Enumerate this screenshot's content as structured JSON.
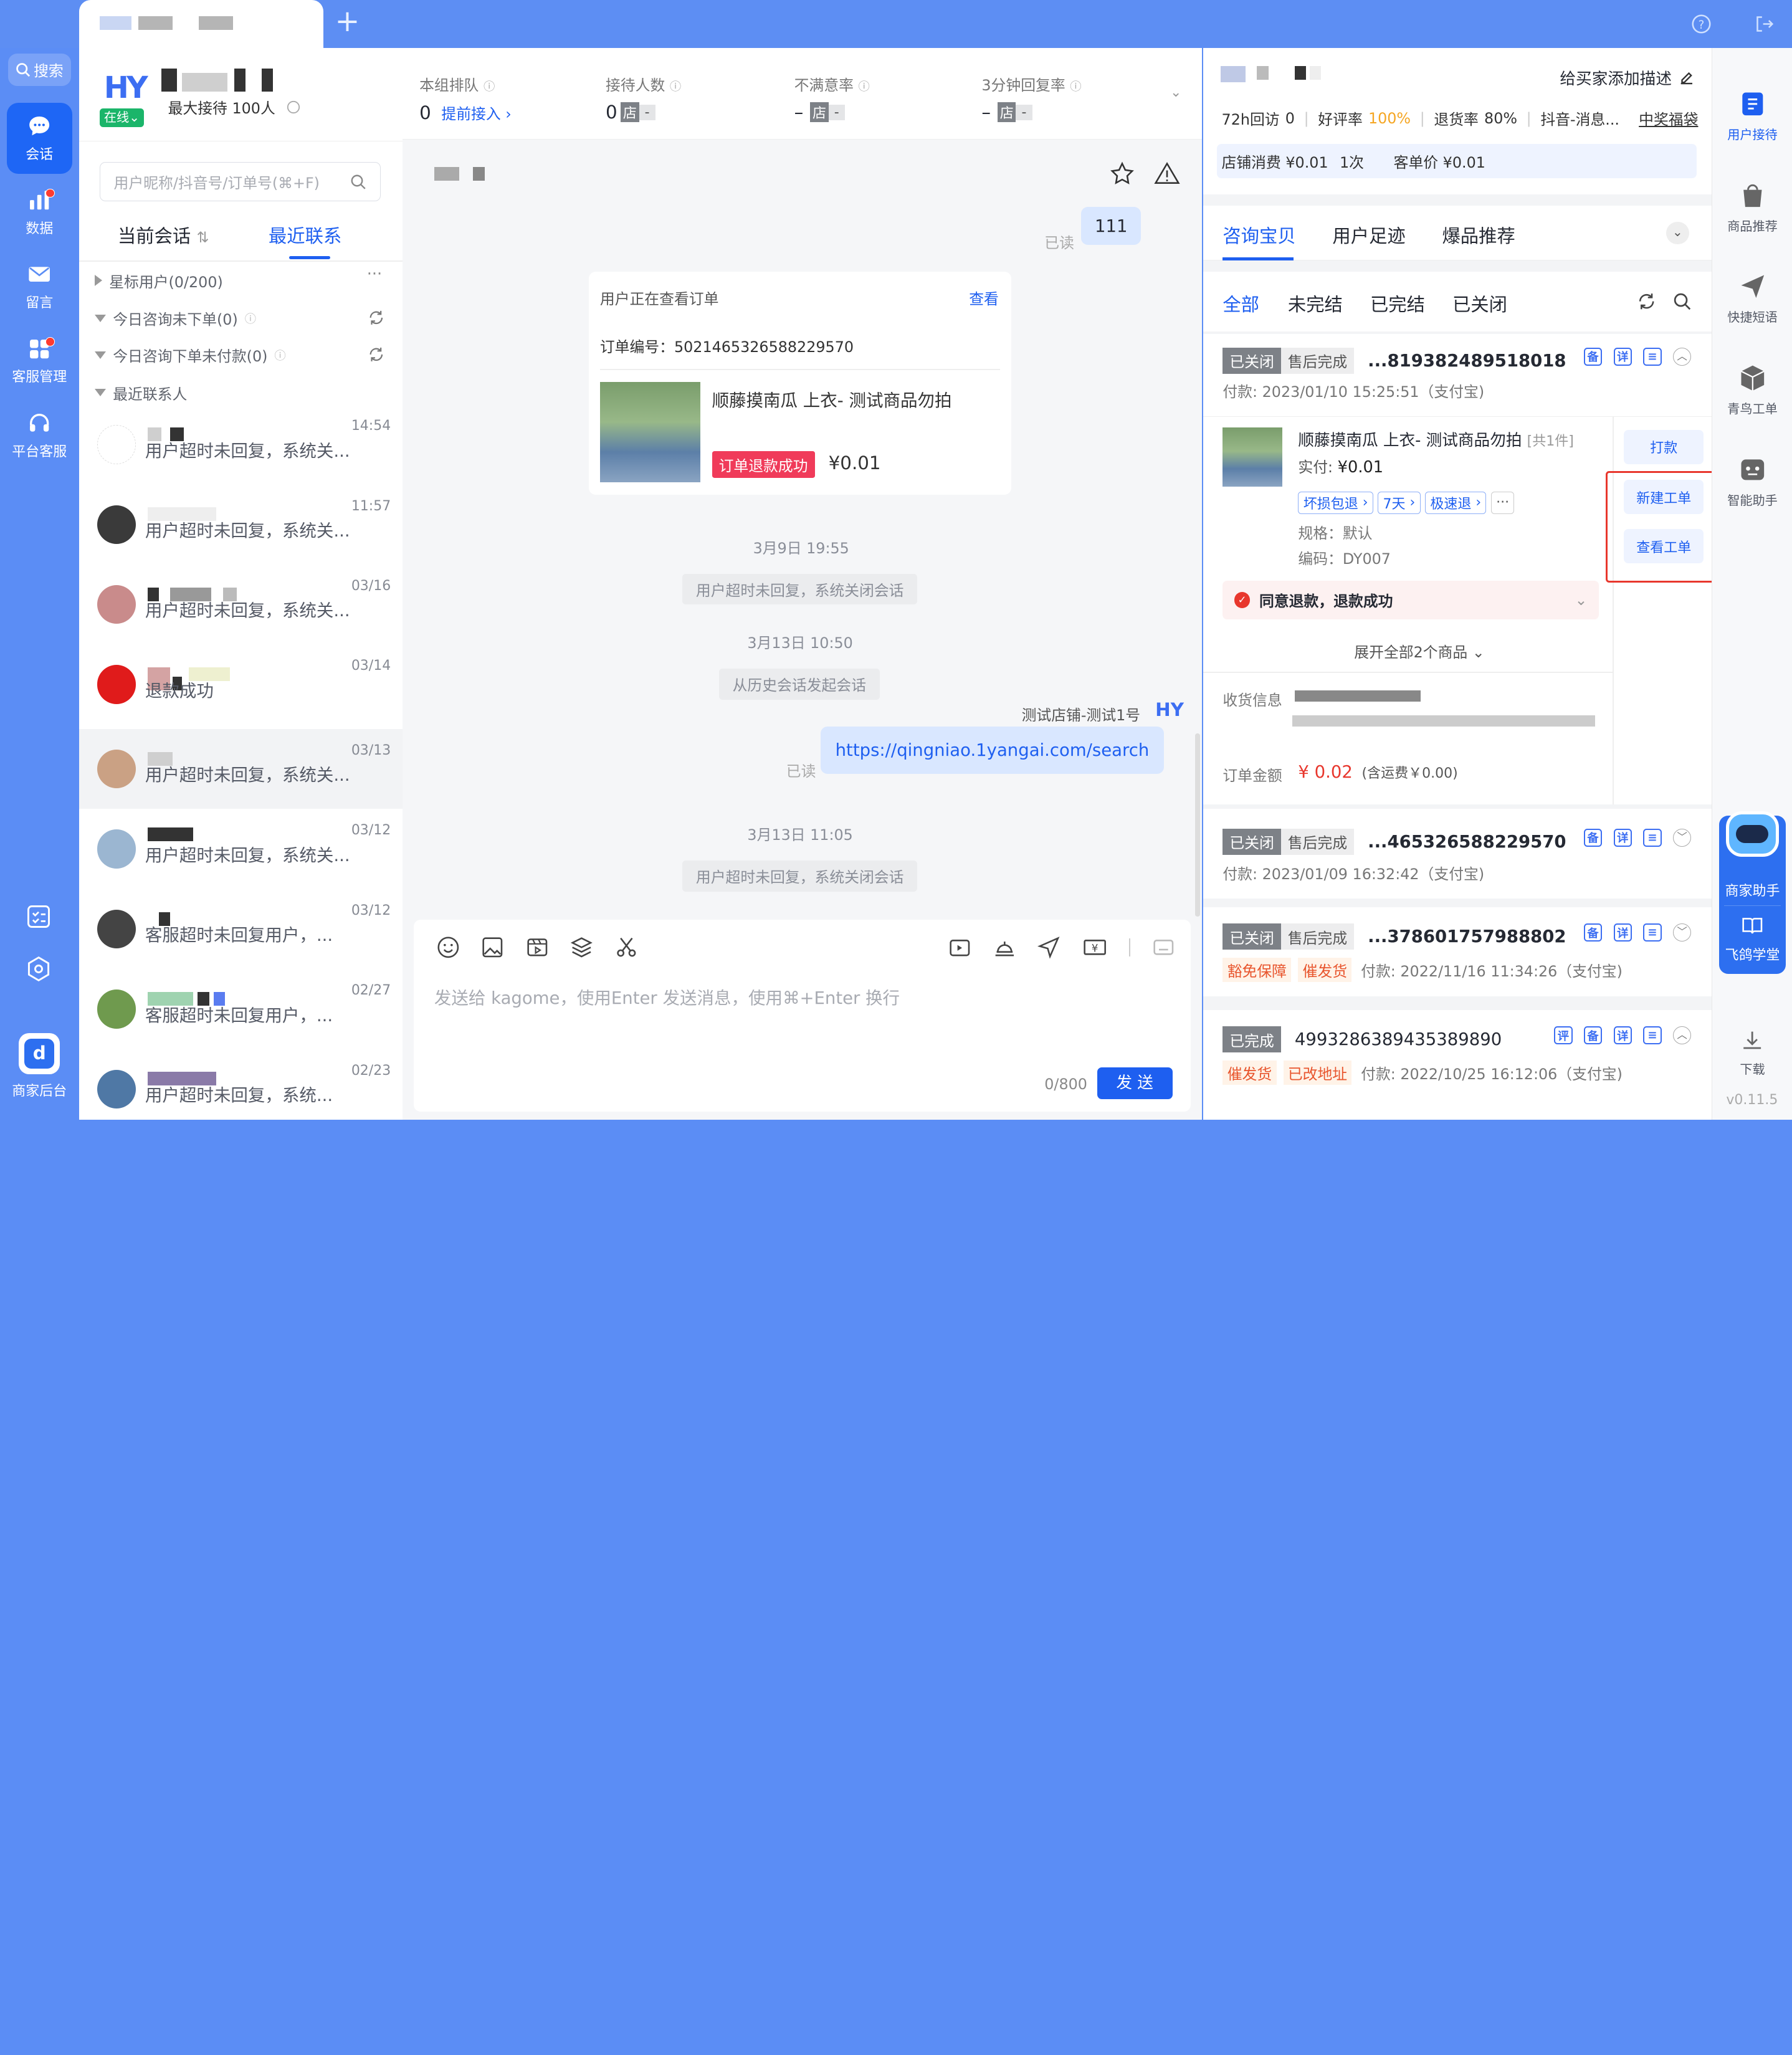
{
  "leftnav": {
    "search": "搜索",
    "items": [
      {
        "label": "会话",
        "icon": "chat-icon",
        "active": true
      },
      {
        "label": "数据",
        "icon": "bar-chart-icon",
        "badge": true
      },
      {
        "label": "留言",
        "icon": "mail-icon"
      },
      {
        "label": "客服管理",
        "icon": "grid-icon",
        "badge": true
      },
      {
        "label": "平台客服",
        "icon": "headset-icon"
      }
    ],
    "bottom_label": "商家后台"
  },
  "profile": {
    "logo": "HY",
    "status": "在线",
    "max_reception": "最大接待 100人"
  },
  "conv": {
    "search_placeholder": "用户昵称/抖音号/订单号(⌘+F)",
    "tabs": [
      "当前会话",
      "最近联系"
    ],
    "groups": [
      "星标用户(0/200)",
      "今日咨询未下单(0)",
      "今日咨询下单未付款(0)",
      "最近联系人"
    ],
    "items": [
      {
        "time": "14:54",
        "msg": "用户超时未回复，系统关..."
      },
      {
        "time": "11:57",
        "msg": "用户超时未回复，系统关..."
      },
      {
        "time": "03/16",
        "msg": "用户超时未回复，系统关..."
      },
      {
        "time": "03/14",
        "msg": "退款成功"
      },
      {
        "time": "03/13",
        "msg": "用户超时未回复，系统关..."
      },
      {
        "time": "03/12",
        "msg": "用户超时未回复，系统关..."
      },
      {
        "time": "03/12",
        "msg": "客服超时未回复用户，..."
      },
      {
        "time": "02/27",
        "msg": "客服超时未回复用户，..."
      },
      {
        "time": "02/23",
        "msg": "用户超时未回复，系统..."
      }
    ]
  },
  "stats": [
    {
      "label": "本组排队",
      "value": "0",
      "extra": "提前接入"
    },
    {
      "label": "接待人数",
      "value": "0",
      "badge": "店",
      "dash": "-"
    },
    {
      "label": "不满意率",
      "value": "–",
      "badge": "店",
      "dash": "-"
    },
    {
      "label": "3分钟回复率",
      "value": "–",
      "badge": "店",
      "dash": "-"
    }
  ],
  "chat": {
    "read": "已读",
    "msg1": "111",
    "order_card": {
      "title": "用户正在查看订单",
      "view": "查看",
      "order_no_label": "订单编号：",
      "order_no": "5021465326588229570",
      "product": "顺藤摸南瓜 上衣- 测试商品勿拍",
      "status": "订单退款成功",
      "price": "¥0.01"
    },
    "d1": "3月9日 19:55",
    "s1": "用户超时未回复，系统关闭会话",
    "d2": "3月13日 10:50",
    "s2": "从历史会话发起会话",
    "sender": "测试店铺-测试1号",
    "link": "https://qingniao.1yangai.com/search",
    "d3": "3月13日 11:05",
    "s3": "用户超时未回复，系统关闭会话",
    "input_placeholder": "发送给 kagome，使用Enter 发送消息，使用⌘+Enter 换行",
    "counter": "0/800",
    "send": "发 送"
  },
  "buyer": {
    "add_desc": "给买家添加描述",
    "m1_label": "72h回访",
    "m1": "0",
    "m2_label": "好评率",
    "m2": "100%",
    "m3_label": "退货率",
    "m3": "80%",
    "m4": "抖音-消息...",
    "m5": "中奖福袋",
    "spend": "店铺消费 ¥0.01",
    "times": "1次",
    "avg": "客单价 ¥0.01"
  },
  "rtabs": [
    "咨询宝贝",
    "用户足迹",
    "爆品推荐"
  ],
  "otabs": [
    "全部",
    "未完结",
    "已完结",
    "已关闭"
  ],
  "orders": [
    {
      "tag1": "已关闭",
      "tag2": "售后完成",
      "no": "...819382489518018",
      "pay": "付款: 2023/01/10 15:25:51（支付宝)"
    },
    {
      "tag1": "已关闭",
      "tag2": "售后完成",
      "no": "...465326588229570",
      "pay": "付款: 2023/01/09 16:32:42（支付宝)"
    },
    {
      "tag1": "已关闭",
      "tag2": "售后完成",
      "no": "...378601757988802",
      "pay": "付款: 2022/11/16 11:34:26（支付宝)",
      "flags": [
        "豁免保障",
        "催发货"
      ]
    },
    {
      "tag1": "已完成",
      "no": "4993286389435389890",
      "pay": "付款: 2022/10/25 16:12:06（支付宝)",
      "flags": [
        "催发货",
        "已改地址"
      ]
    }
  ],
  "order_detail": {
    "product": "顺藤摸南瓜 上衣- 测试商品勿拍",
    "count": "[共1件]",
    "paid_label": "实付:",
    "paid": "¥0.01",
    "chips": [
      "坏损包退",
      "7天",
      "极速退"
    ],
    "spec": "规格：默认",
    "code": "编码：DY007",
    "btn_pay": "打款",
    "btn_new": "新建工单",
    "btn_view": "查看工单",
    "refund": "同意退款，退款成功",
    "expand": "展开全部2个商品",
    "addr_label": "收货信息",
    "amount_label": "订单金额",
    "amount": "¥ 0.02",
    "shipping": "(含运费￥0.00)"
  },
  "icon_letters": [
    "备",
    "详"
  ],
  "rightbar": {
    "items": [
      "用户接待",
      "商品推荐",
      "快捷短语",
      "青鸟工单",
      "智能助手"
    ],
    "assistant": "商家助手",
    "school": "飞鸽学堂",
    "download": "下载",
    "version": "v0.11.5"
  }
}
